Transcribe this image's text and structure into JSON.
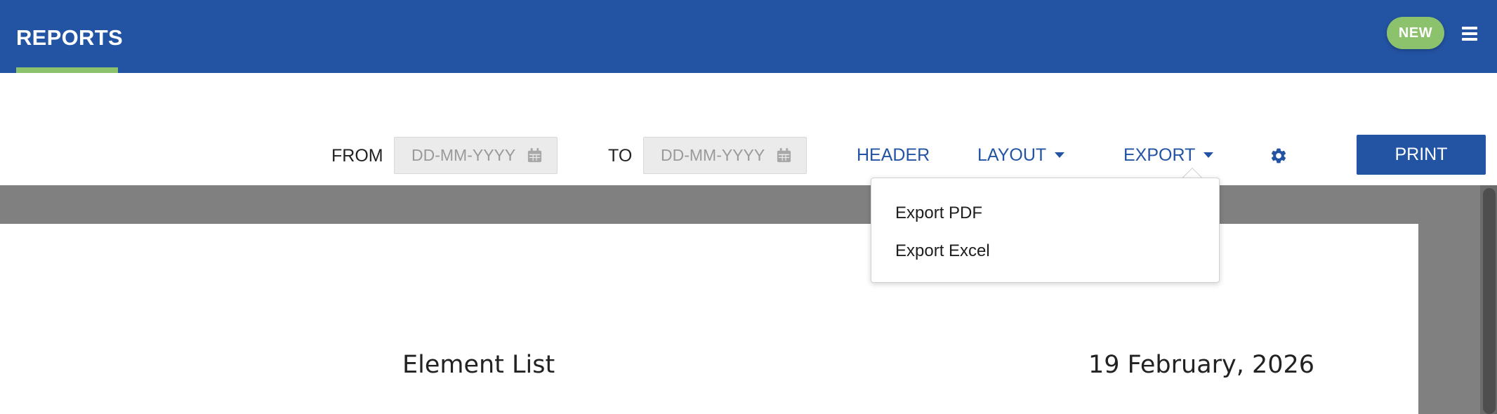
{
  "header": {
    "title": "REPORTS",
    "badge": "NEW",
    "menu_icon": "hamburger-menu-icon"
  },
  "toolbar": {
    "from_label": "FROM",
    "from_placeholder": "DD-MM-YYYY",
    "to_label": "TO",
    "to_placeholder": "DD-MM-YYYY",
    "calendar_icon": "calendar-icon",
    "header_link": "HEADER",
    "layout_link": "LAYOUT",
    "export_link": "EXPORT",
    "settings_icon": "gear-icon",
    "print_label": "PRINT"
  },
  "export_menu": {
    "items": [
      "Export PDF",
      "Export Excel"
    ]
  },
  "document": {
    "title": "Element List",
    "date": "19 February, 2026"
  },
  "colors": {
    "primary": "#2354a4",
    "accent": "#8dc26d",
    "canvas_gray": "#808080"
  }
}
